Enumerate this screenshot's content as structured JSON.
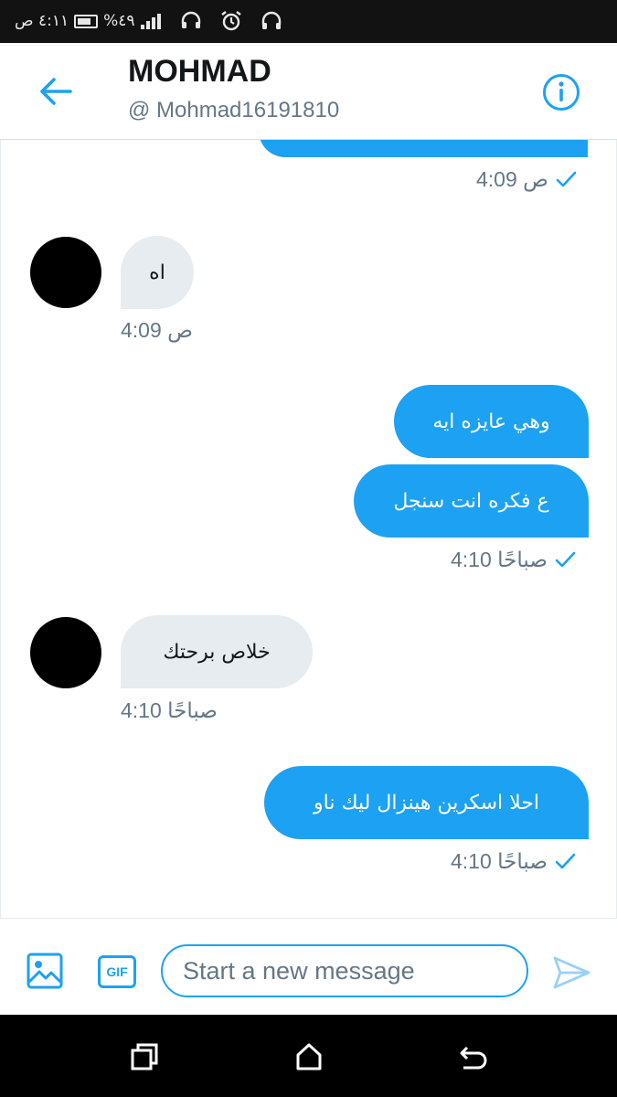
{
  "status_bar": {
    "time": "٤:١١ ص",
    "battery": "%٤٩"
  },
  "header": {
    "title": "MOHMAD",
    "handle": "@ Mohmad16191810"
  },
  "messages": [
    {
      "direction": "out",
      "text": "",
      "note": "partially scrolled"
    },
    {
      "direction": "meta",
      "time": "4:09 ص",
      "read": true
    },
    {
      "direction": "in",
      "text": "اه"
    },
    {
      "direction": "meta",
      "time": "4:09 ص",
      "read": false
    },
    {
      "direction": "out",
      "text": "وهي عايزه ايه"
    },
    {
      "direction": "out",
      "text": "ع فكره انت سنجل"
    },
    {
      "direction": "meta",
      "time": "4:10 صباحًا",
      "read": true
    },
    {
      "direction": "in",
      "text": "خلاص برحتك"
    },
    {
      "direction": "meta",
      "time": "4:10 صباحًا",
      "read": false
    },
    {
      "direction": "out",
      "text": "احلا اسكرين هينزال ليك ناو"
    },
    {
      "direction": "meta",
      "time": "4:10 صباحًا",
      "read": true
    }
  ],
  "composer": {
    "placeholder": "Start a new message",
    "gif_label": "GIF"
  },
  "colors": {
    "accent": "#1da1f2",
    "incoming_bubble": "#e6ecf0",
    "text": "#14171a",
    "muted": "#657786"
  },
  "icons": [
    "back-arrow-icon",
    "info-icon",
    "checkmark-icon",
    "image-icon",
    "gif-icon",
    "send-icon",
    "recent-apps-icon",
    "home-icon",
    "back-icon"
  ]
}
